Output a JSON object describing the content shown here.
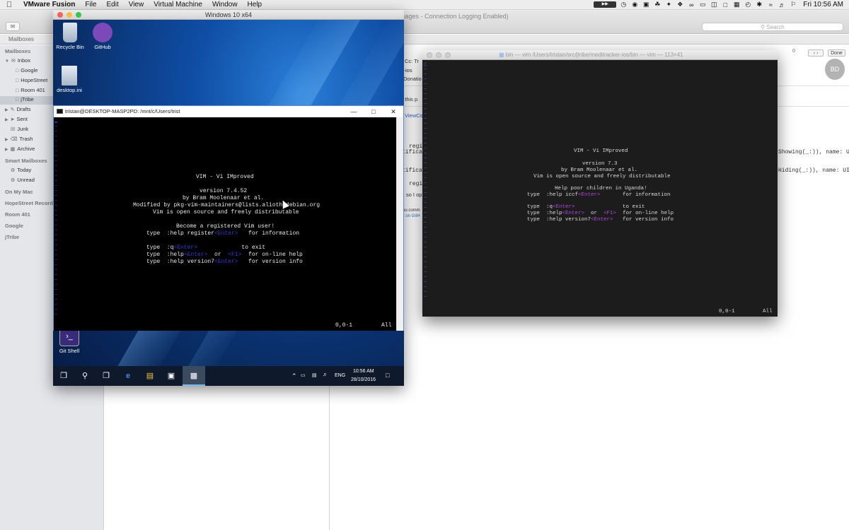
{
  "menubar": {
    "app": "VMware Fusion",
    "items": [
      "File",
      "Edit",
      "View",
      "Virtual Machine",
      "Window",
      "Help"
    ],
    "clock": "Fri 10:56 AM"
  },
  "mail": {
    "window_title": "sages - Connection Logging Enabled)",
    "search_placeholder": "Search",
    "fav_mailboxes": "Mailboxes",
    "sidebar": {
      "mailboxes_header": "Mailboxes",
      "inbox": "Inbox",
      "inbox_children": [
        "Google",
        "HopeStreet",
        "Room 401",
        "jTribe"
      ],
      "folders": [
        "Drafts",
        "Sent",
        "Junk",
        "Trash",
        "Archive"
      ],
      "smart_header": "Smart Mailboxes",
      "smart": [
        "Today",
        "Unread"
      ],
      "accounts": [
        "On My Mac",
        "HopeStreet Recordi",
        "Room 401",
        "Google",
        "jTribe"
      ]
    },
    "view_fragments": {
      "cc": "Cc:  Tr",
      "ios": "r-ios",
      "donation": "Donatio",
      "this_p": "n this p",
      "viewco": "ViewCo",
      "regis1": "regis",
      "tifica1": "tifica",
      "regis2": "regis",
      "tifica2": "tifica",
      "x_so": "x, so I op",
      "you_comm": "ou comm",
      "t_on": "t on GitH",
      "showing": "Showing(_:)), name: UI",
      "hiding": "Hiding(_:)), name: UIK"
    },
    "avatar": "BD",
    "done": "Done",
    "count": "0"
  },
  "vm": {
    "title": "Windows 10 x64",
    "desktop_icons": [
      "Recycle Bin",
      "GitHub",
      "desktop.ini",
      "Git Shell"
    ],
    "wsl_title": "tristan@DESKTOP-MASP2PD: /mnt/c/Users/trist",
    "vim_lines": {
      "title": "VIM - Vi IMproved",
      "version": "version 7.4.52",
      "author": "by Bram Moolenaar et al.",
      "modified": "Modified by pkg-vim-maintainers@lists.alioth.debian.org",
      "distrib": "Vim is open source and freely distributable",
      "register": "Become a registered Vim user!",
      "help_reg_a": "type  :help register",
      "help_reg_b": "<Enter>",
      "help_reg_c": "   for information",
      "exit_a": "type  :q",
      "exit_b": "<Enter>",
      "exit_c": "             to exit",
      "help_a": "type  :help",
      "help_b": "<Enter>",
      "help_c": "  or  ",
      "help_d": "<F1>",
      "help_e": "  for on-line help",
      "ver_a": "type  :help version7",
      "ver_b": "<Enter>",
      "ver_c": "   for version info"
    },
    "status_pos": "0,0-1",
    "status_all": "All",
    "taskbar": {
      "lang": "ENG",
      "time": "10:56 AM",
      "date": "28/10/2016"
    }
  },
  "terminal": {
    "title": "bin — vim  /Users/tristan/src/jtribe/meditracker-ios/bin — vim — 113×41",
    "vim_lines": {
      "title": "VIM - Vi IMproved",
      "version": "version 7.3",
      "author": "by Bram Moolenaar et al.",
      "distrib": "Vim is open source and freely distributable",
      "uganda": "Help poor children in Uganda!",
      "iccf_a": "type  :help iccf",
      "iccf_b": "<Enter>",
      "iccf_c": "       for information",
      "exit_a": "type  :q",
      "exit_b": "<Enter>",
      "exit_c": "               to exit",
      "help_a": "type  :help",
      "help_b": "<Enter>",
      "help_c": "  or  ",
      "help_d": "<F1>",
      "help_e": "  for on-line help",
      "ver_a": "type  :help version7",
      "ver_b": "<Enter>",
      "ver_c": "   for version info"
    },
    "status_pos": "0,0-1",
    "status_all": "All"
  }
}
